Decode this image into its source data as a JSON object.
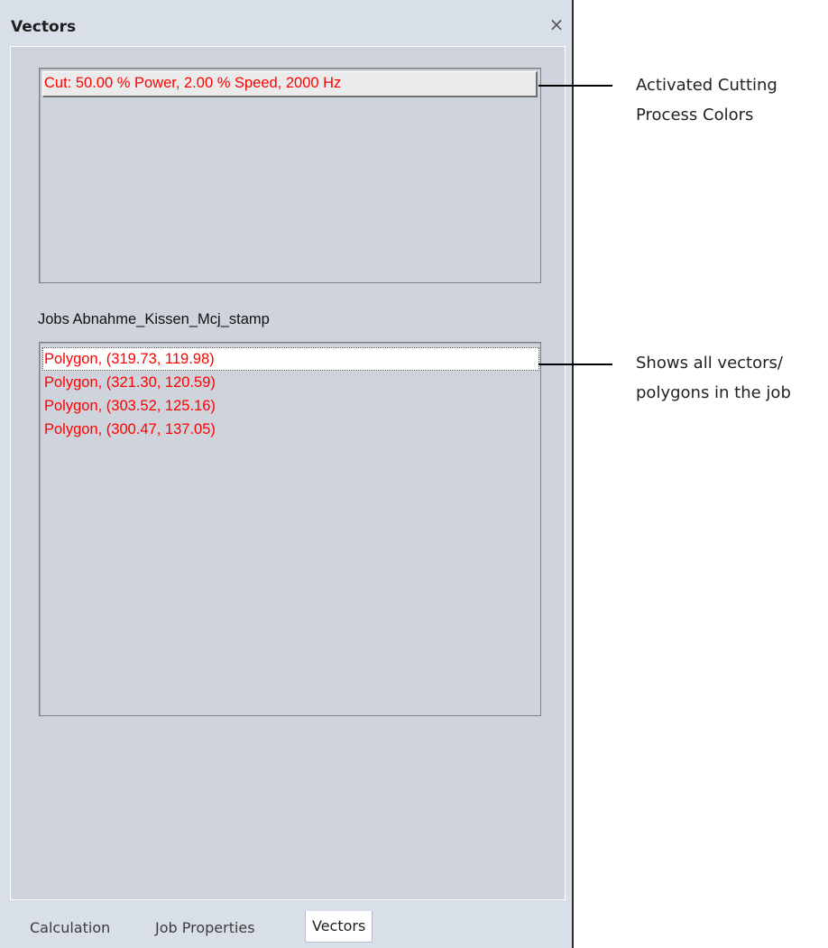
{
  "panel": {
    "title": "Vectors",
    "close_label": "×"
  },
  "colors_box": {
    "items": [
      {
        "label": "Cut: 50.00 % Power, 2.00 % Speed, 2000 Hz",
        "color": "#ff0000"
      }
    ]
  },
  "job": {
    "label": "Jobs Abnahme_Kissen_Mcj_stamp"
  },
  "vectors": {
    "items": [
      {
        "label": "Polygon, (319.73, 119.98)",
        "selected": true,
        "color": "#ff0000"
      },
      {
        "label": "Polygon, (321.30, 120.59)",
        "selected": false,
        "color": "#ff0000"
      },
      {
        "label": "Polygon, (303.52, 125.16)",
        "selected": false,
        "color": "#ff0000"
      },
      {
        "label": "Polygon, (300.47, 137.05)",
        "selected": false,
        "color": "#ff0000"
      }
    ]
  },
  "tabs": [
    {
      "label": "Calculation",
      "active": false
    },
    {
      "label": "Job Properties",
      "active": false
    },
    {
      "label": "Vectors",
      "active": true
    }
  ],
  "annotations": {
    "colors_callout": [
      "Activated Cutting",
      "Process Colors"
    ],
    "vectors_callout": [
      "Shows all vectors/",
      "polygons in the job"
    ]
  }
}
